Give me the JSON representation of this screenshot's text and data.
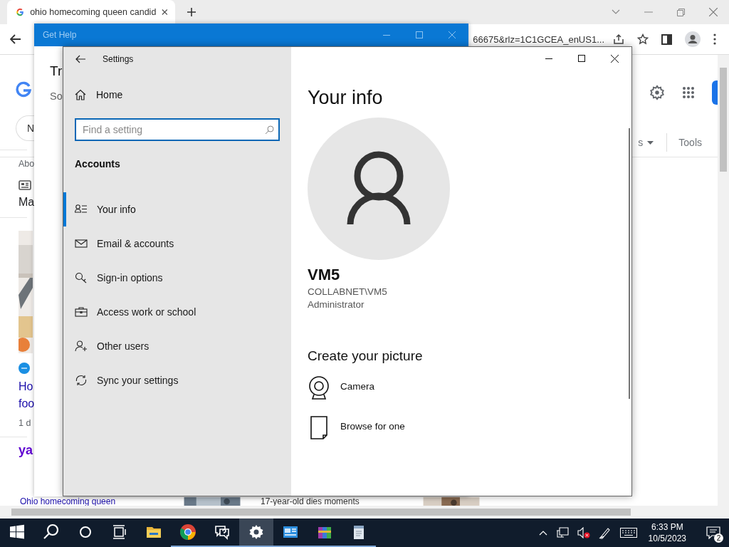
{
  "browser": {
    "tab_title": "ohio homecoming queen candid",
    "address_fragment": "66675&rlz=1C1GCEA_enUS1...",
    "page_left": [
      {
        "kind": "logo"
      },
      {
        "kind": "chip",
        "text": "N"
      },
      {
        "kind": "divider"
      },
      {
        "kind": "meta",
        "text": "Abo"
      },
      {
        "kind": "newsicon"
      },
      {
        "kind": "heading",
        "text": "Ma"
      },
      {
        "kind": "divider"
      },
      {
        "kind": "picture"
      },
      {
        "kind": "sourceicon"
      },
      {
        "kind": "link",
        "text": "Ho"
      },
      {
        "kind": "link",
        "text": "foo"
      },
      {
        "kind": "meta",
        "text": "1 d"
      },
      {
        "kind": "divider"
      },
      {
        "kind": "brand",
        "text": "ya"
      }
    ],
    "bottom_links": [
      "Ohio homecoming queen",
      "17-year-old dies moments"
    ],
    "filter_fragment": "s",
    "tools": "Tools"
  },
  "get_help": {
    "title": "Get Help",
    "fragments": [
      "Tr",
      "So"
    ]
  },
  "settings": {
    "title": "Settings",
    "home": "Home",
    "search": {
      "placeholder": "Find a setting"
    },
    "section": "Accounts",
    "nav": [
      {
        "kind": "info",
        "label": "Your info",
        "selected": true
      },
      {
        "kind": "mail",
        "label": "Email & accounts",
        "selected": false
      },
      {
        "kind": "key",
        "label": "Sign-in options",
        "selected": false
      },
      {
        "kind": "case",
        "label": "Access work or school",
        "selected": false
      },
      {
        "kind": "user",
        "label": "Other users",
        "selected": false
      },
      {
        "kind": "sync",
        "label": "Sync your settings",
        "selected": false
      }
    ],
    "page_title": "Your info",
    "user_name": "VM5",
    "account": "COLLABNET\\VM5",
    "role": "Administrator",
    "picture_heading": "Create your picture",
    "picture_options": [
      {
        "kind": "camera",
        "label": "Camera"
      },
      {
        "kind": "browse",
        "label": "Browse for one"
      }
    ]
  },
  "taskbar": {
    "apps": [
      {
        "kind": "start",
        "running": false,
        "selected": false
      },
      {
        "kind": "search",
        "running": false,
        "selected": false
      },
      {
        "kind": "cortana",
        "running": false,
        "selected": false
      },
      {
        "kind": "taskview",
        "running": false,
        "selected": false
      },
      {
        "kind": "explorer",
        "running": false,
        "selected": false
      },
      {
        "kind": "chrome",
        "running": true,
        "selected": false
      },
      {
        "kind": "feedback",
        "running": true,
        "selected": false
      },
      {
        "kind": "settings",
        "running": true,
        "selected": true
      },
      {
        "kind": "app",
        "running": true,
        "selected": false
      },
      {
        "kind": "archive",
        "running": true,
        "selected": false
      },
      {
        "kind": "notepad",
        "running": true,
        "selected": false
      }
    ],
    "time": "6:33 PM",
    "date": "10/5/2023",
    "notifications": "2"
  }
}
